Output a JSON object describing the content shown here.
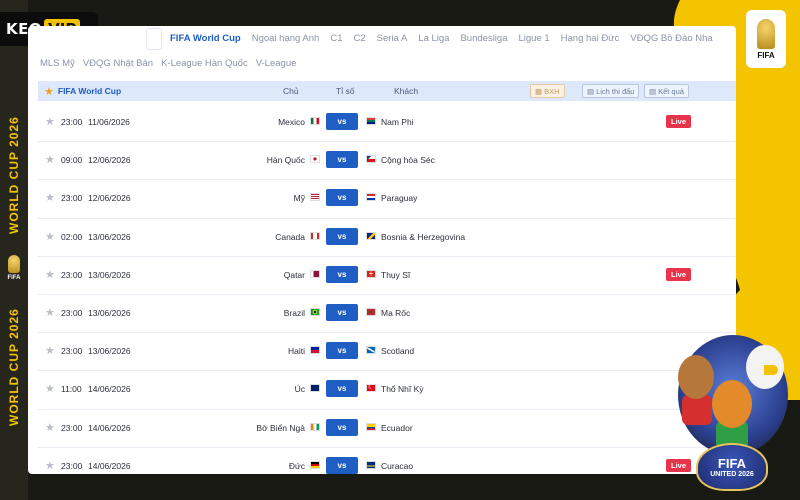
{
  "brand": {
    "keo": "KEO",
    "vip": "VIP",
    "accent": "#f5c400"
  },
  "side_text": {
    "top": "WORLD CUP 2026",
    "bottom": "WORLD CUP 2026",
    "mini_fifa": "FIFA"
  },
  "badge": {
    "label": "FIFA"
  },
  "mascot": {
    "fifa": "FIFA",
    "united": "UNITED 2026"
  },
  "tabs": {
    "active": "FIFA World Cup",
    "row1": [
      "Ngoại hạng Anh",
      "C1",
      "C2",
      "Seria A",
      "La Liga",
      "Bundesliga",
      "Ligue 1",
      "Hạng hai Đức",
      "VĐQG Bồ Đào Nha"
    ],
    "row2": [
      "MLS Mỹ",
      "VĐQG Nhật Bản",
      "K-League Hàn Quốc",
      "V-League"
    ]
  },
  "header": {
    "league": "FIFA World Cup",
    "home_col": "Chủ",
    "score_col": "Tỉ số",
    "away_col": "Khách",
    "btn_bxh": "BXH",
    "btn_schedule": "Lịch thi đấu",
    "btn_results": "Kết quả"
  },
  "matches": [
    {
      "time": "23:00",
      "date": "11/06/2026",
      "home": "Mexico",
      "vs": "vs",
      "away": "Nam Phi",
      "live": "Live",
      "home_flag": "mexico",
      "away_flag": "south-africa"
    },
    {
      "time": "09:00",
      "date": "12/06/2026",
      "home": "Hàn Quốc",
      "vs": "vs",
      "away": "Cộng hòa Séc",
      "live": "",
      "home_flag": "south-korea",
      "away_flag": "czechia"
    },
    {
      "time": "23:00",
      "date": "12/06/2026",
      "home": "Mỹ",
      "vs": "vs",
      "away": "Paraguay",
      "live": "",
      "home_flag": "usa",
      "away_flag": "paraguay"
    },
    {
      "time": "02:00",
      "date": "13/06/2026",
      "home": "Canada",
      "vs": "vs",
      "away": "Bosnia & Herzegovina",
      "live": "",
      "home_flag": "canada",
      "away_flag": "bosnia"
    },
    {
      "time": "23:00",
      "date": "13/06/2026",
      "home": "Qatar",
      "vs": "vs",
      "away": "Thụy Sĩ",
      "live": "Live",
      "home_flag": "qatar",
      "away_flag": "switzerland"
    },
    {
      "time": "23:00",
      "date": "13/06/2026",
      "home": "Brazil",
      "vs": "vs",
      "away": "Ma Rốc",
      "live": "",
      "home_flag": "brazil",
      "away_flag": "morocco"
    },
    {
      "time": "23:00",
      "date": "13/06/2026",
      "home": "Haiti",
      "vs": "vs",
      "away": "Scotland",
      "live": "",
      "home_flag": "haiti",
      "away_flag": "scotland"
    },
    {
      "time": "11:00",
      "date": "14/06/2026",
      "home": "Úc",
      "vs": "vs",
      "away": "Thổ Nhĩ Kỳ",
      "live": "",
      "home_flag": "australia",
      "away_flag": "turkey"
    },
    {
      "time": "23:00",
      "date": "14/06/2026",
      "home": "Bờ Biển Ngà",
      "vs": "vs",
      "away": "Ecuador",
      "live": "",
      "home_flag": "ivory-coast",
      "away_flag": "ecuador"
    },
    {
      "time": "23:00",
      "date": "14/06/2026",
      "home": "Đức",
      "vs": "vs",
      "away": "Curacao",
      "live": "Live",
      "home_flag": "germany",
      "away_flag": "curacao"
    }
  ]
}
